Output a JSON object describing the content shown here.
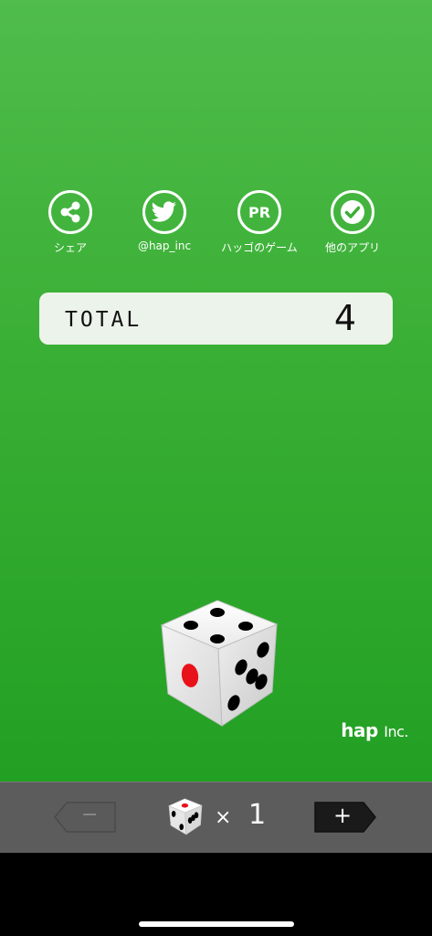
{
  "share_row": {
    "share_label": "シェア",
    "twitter_label": "@hap_inc",
    "pr_label": "ハッゴのゲーム",
    "pr_badge": "PR",
    "other_apps_label": "他のアプリ"
  },
  "total": {
    "label": "TOTAL",
    "value": "4"
  },
  "brand": {
    "name": "hap",
    "suffix": "Inc."
  },
  "toolbar": {
    "minus_label": "−",
    "plus_label": "+",
    "times_symbol": "×",
    "dice_count": "1"
  },
  "colors": {
    "background_top": "#4fbc4b",
    "background_bottom": "#22a023",
    "toolbar": "#5c5c5c",
    "total_box": "#ecf3ea",
    "pip_red": "#e8121a"
  }
}
